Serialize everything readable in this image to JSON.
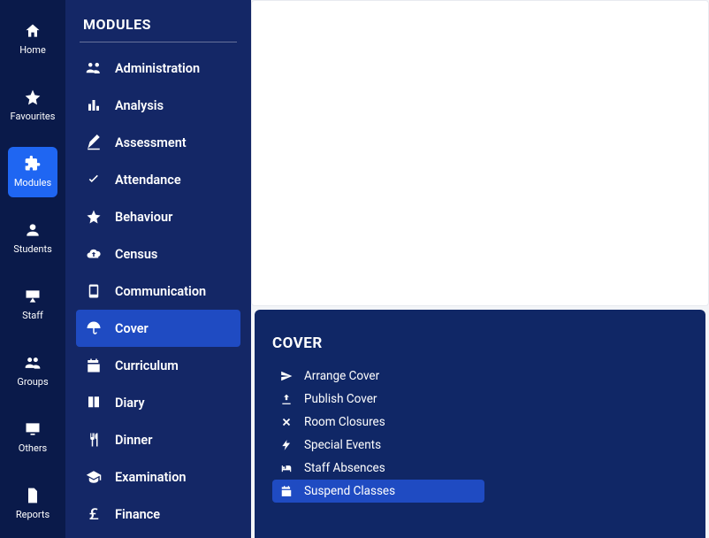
{
  "rail": {
    "items": [
      {
        "label": "Home",
        "icon": "home-icon",
        "active": false
      },
      {
        "label": "Favourites",
        "icon": "star-icon",
        "active": false
      },
      {
        "label": "Modules",
        "icon": "puzzle-icon",
        "active": true
      },
      {
        "label": "Students",
        "icon": "user-icon",
        "active": false
      },
      {
        "label": "Staff",
        "icon": "board-icon",
        "active": false
      },
      {
        "label": "Groups",
        "icon": "users-icon",
        "active": false
      },
      {
        "label": "Others",
        "icon": "monitor-icon",
        "active": false
      },
      {
        "label": "Reports",
        "icon": "document-icon",
        "active": false
      }
    ]
  },
  "modules": {
    "title": "MODULES",
    "items": [
      {
        "label": "Administration",
        "icon": "people-icon",
        "active": false
      },
      {
        "label": "Analysis",
        "icon": "bars-icon",
        "active": false
      },
      {
        "label": "Assessment",
        "icon": "pencil-icon",
        "active": false
      },
      {
        "label": "Attendance",
        "icon": "check-icon",
        "active": false
      },
      {
        "label": "Behaviour",
        "icon": "star-icon",
        "active": false
      },
      {
        "label": "Census",
        "icon": "cloud-up-icon",
        "active": false
      },
      {
        "label": "Communication",
        "icon": "phone-icon",
        "active": false
      },
      {
        "label": "Cover",
        "icon": "umbrella-icon",
        "active": true
      },
      {
        "label": "Curriculum",
        "icon": "calendar-icon",
        "active": false
      },
      {
        "label": "Diary",
        "icon": "book-icon",
        "active": false
      },
      {
        "label": "Dinner",
        "icon": "cutlery-icon",
        "active": false
      },
      {
        "label": "Examination",
        "icon": "grad-icon",
        "active": false
      },
      {
        "label": "Finance",
        "icon": "pound-icon",
        "active": false
      }
    ]
  },
  "submenu": {
    "title": "COVER",
    "items": [
      {
        "label": "Arrange Cover",
        "icon": "send-icon",
        "active": false
      },
      {
        "label": "Publish Cover",
        "icon": "upload-icon",
        "active": false
      },
      {
        "label": "Room Closures",
        "icon": "close-icon",
        "active": false
      },
      {
        "label": "Special Events",
        "icon": "flash-icon",
        "active": false
      },
      {
        "label": "Staff Absences",
        "icon": "bed-icon",
        "active": false
      },
      {
        "label": "Suspend Classes",
        "icon": "calendar-icon",
        "active": true
      }
    ]
  },
  "colors": {
    "rail_bg": "#0a1a4a",
    "panel_bg": "#142766",
    "active_bg": "#1f4bc2",
    "rail_active_bg": "#1f66f2"
  }
}
